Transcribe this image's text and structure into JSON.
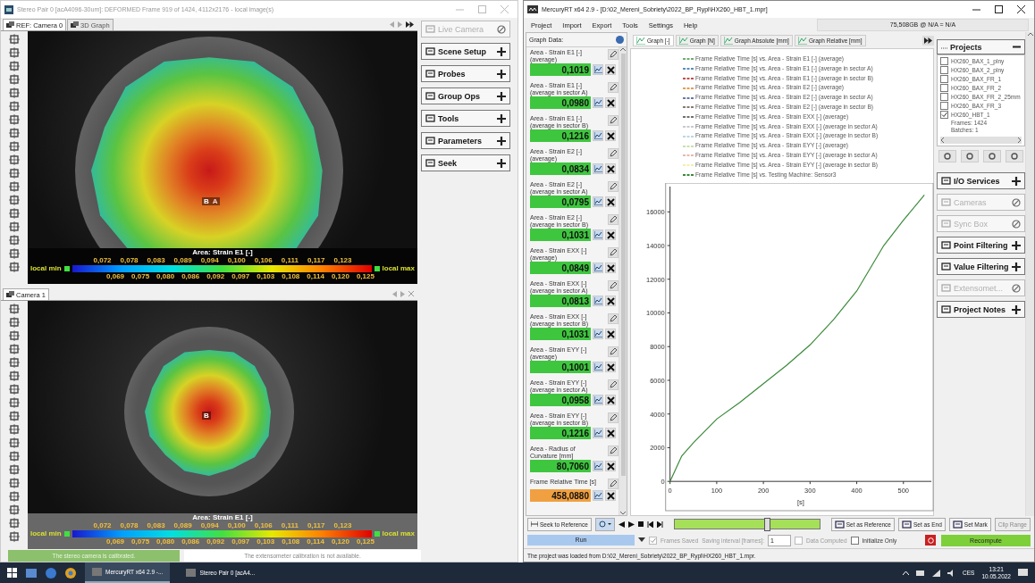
{
  "stereo_window": {
    "title": "Stereo Pair 0 [acA4096-30um]: DEFORMED Frame 919 of 1424, 4112x2176 - local image(s)",
    "viewers": [
      {
        "tabs": [
          {
            "label": "REF: Camera 0",
            "selected": true
          },
          {
            "label": "3D Graph",
            "selected": false
          }
        ],
        "probe_labels": [
          "B",
          "A"
        ],
        "colorbar": {
          "title": "Area: Strain E1 [-]",
          "min_label": "local min",
          "max_label": "local max",
          "upper_ticks": [
            "0,072",
            "0,078",
            "0,083",
            "0,089",
            "0,094",
            "0,100",
            "0,106",
            "0,111",
            "0,117",
            "0,123"
          ],
          "lower_ticks": [
            "0,069",
            "0,075",
            "0,080",
            "0,086",
            "0,092",
            "0,097",
            "0,103",
            "0,108",
            "0,114",
            "0,120",
            "0,125"
          ]
        }
      },
      {
        "tabs": [
          {
            "label": "Camera 1",
            "selected": true
          }
        ],
        "probe_labels": [
          "B"
        ],
        "colorbar": {
          "title": "Area: Strain E1 [-]",
          "min_label": "local min",
          "max_label": "local max",
          "upper_ticks": [
            "0,072",
            "0,078",
            "0,083",
            "0,089",
            "0,094",
            "0,100",
            "0,106",
            "0,111",
            "0,117",
            "0,123"
          ],
          "lower_ticks": [
            "0,069",
            "0,075",
            "0,080",
            "0,086",
            "0,092",
            "0,097",
            "0,103",
            "0,108",
            "0,114",
            "0,120",
            "0,125"
          ]
        }
      }
    ],
    "sidebar": [
      {
        "label": "Live Camera",
        "disabled": true
      },
      {
        "label": "Scene Setup",
        "disabled": false
      },
      {
        "label": "Probes",
        "disabled": false
      },
      {
        "label": "Group Ops",
        "disabled": false
      },
      {
        "label": "Tools",
        "disabled": false
      },
      {
        "label": "Parameters",
        "disabled": false
      },
      {
        "label": "Seek",
        "disabled": false
      }
    ],
    "status": [
      {
        "text": "The stereo camera is calibrated.",
        "kind": "ok"
      },
      {
        "text": "The extensometer calibration is not available.",
        "kind": "info"
      }
    ]
  },
  "mercury_window": {
    "title": "MercuryRT x64 2.9 - [D:\\02_Mereni_Sobriety\\2022_BP_Rypl\\HX260_HBT_1.mpr]",
    "menu": [
      "Project",
      "Import",
      "Export",
      "Tools",
      "Settings",
      "Help"
    ],
    "storage": "75,508GB @ N/A = N/A",
    "graph_data": {
      "title": "Graph Data:",
      "items": [
        {
          "label": "Area - Strain E1 [-]\n(average)",
          "value": "0,1019",
          "color": "#3fc63f"
        },
        {
          "label": "Area - Strain E1 [-]\n(average in sector A)",
          "value": "0,0980",
          "color": "#3fc63f"
        },
        {
          "label": "Area - Strain E1 [-]\n(average in sector B)",
          "value": "0,1216",
          "color": "#3fc63f"
        },
        {
          "label": "Area - Strain E2 [-]\n(average)",
          "value": "0,0834",
          "color": "#3fc63f"
        },
        {
          "label": "Area - Strain E2 [-]\n(average in sector A)",
          "value": "0,0795",
          "color": "#3fc63f"
        },
        {
          "label": "Area - Strain E2 [-]\n(average in sector B)",
          "value": "0,1031",
          "color": "#3fc63f"
        },
        {
          "label": "Area - Strain EXX [-]\n(average)",
          "value": "0,0849",
          "color": "#3fc63f"
        },
        {
          "label": "Area - Strain EXX [-]\n(average in sector A)",
          "value": "0,0813",
          "color": "#3fc63f"
        },
        {
          "label": "Area - Strain EXX [-]\n(average in sector B)",
          "value": "0,1031",
          "color": "#3fc63f"
        },
        {
          "label": "Area - Strain EYY [-]\n(average)",
          "value": "0,1001",
          "color": "#3fc63f"
        },
        {
          "label": "Area - Strain EYY [-]\n(average in sector A)",
          "value": "0,0958",
          "color": "#3fc63f"
        },
        {
          "label": "Area - Strain EYY [-]\n(average in sector B)",
          "value": "0,1216",
          "color": "#3fc63f"
        },
        {
          "label": "Area - Radius of\nCurvature [mm]",
          "value": "80,7060",
          "color": "#3fc63f"
        },
        {
          "label": "Frame Relative Time [s]",
          "value": "458,0880",
          "color": "#f0a040"
        }
      ]
    },
    "graph": {
      "tabs": [
        {
          "label": "Graph [-]",
          "selected": true
        },
        {
          "label": "Graph [N]",
          "selected": false
        },
        {
          "label": "Graph Absolute [mm]",
          "selected": false
        },
        {
          "label": "Graph Relative [mm]",
          "selected": false
        }
      ],
      "chart_data": {
        "type": "line",
        "xlabel": "[s]",
        "x": [
          0,
          25,
          50,
          100,
          150,
          200,
          250,
          300,
          350,
          400,
          458,
          500,
          545
        ],
        "series": [
          {
            "name": "Frame Relative Time [s] vs. Area - Strain E1 [-] (average)",
            "color": "#6fae6f",
            "values": [
              null,
              null,
              null,
              null,
              null,
              null,
              null,
              null,
              null,
              null,
              null,
              null,
              null
            ]
          },
          {
            "name": "Frame Relative Time [s] vs. Area - Strain E1 [-] (average in sector A)",
            "color": "#5a8ec0",
            "values": [
              null,
              null,
              null,
              null,
              null,
              null,
              null,
              null,
              null,
              null,
              null,
              null,
              null
            ]
          },
          {
            "name": "Frame Relative Time [s] vs. Area - Strain E1 [-] (average in sector B)",
            "color": "#c05050",
            "values": [
              null,
              null,
              null,
              null,
              null,
              null,
              null,
              null,
              null,
              null,
              null,
              null,
              null
            ]
          },
          {
            "name": "Frame Relative Time [s] vs. Area - Strain E2 [-] (average)",
            "color": "#e0a050",
            "values": [
              null,
              null,
              null,
              null,
              null,
              null,
              null,
              null,
              null,
              null,
              null,
              null,
              null
            ]
          },
          {
            "name": "Frame Relative Time [s] vs. Area - Strain E2 [-] (average in sector A)",
            "color": "#6a7aa0",
            "values": [
              null,
              null,
              null,
              null,
              null,
              null,
              null,
              null,
              null,
              null,
              null,
              null,
              null
            ]
          },
          {
            "name": "Frame Relative Time [s] vs. Area - Strain E2 [-] (average in sector B)",
            "color": "#8a7a70",
            "values": [
              null,
              null,
              null,
              null,
              null,
              null,
              null,
              null,
              null,
              null,
              null,
              null,
              null
            ]
          },
          {
            "name": "Frame Relative Time [s] vs. Area - Strain EXX [-] (average)",
            "color": "#707070",
            "values": [
              null,
              null,
              null,
              null,
              null,
              null,
              null,
              null,
              null,
              null,
              null,
              null,
              null
            ]
          },
          {
            "name": "Frame Relative Time [s] vs. Area - Strain EXX [-] (average in sector A)",
            "color": "#c8c8d0",
            "values": [
              null,
              null,
              null,
              null,
              null,
              null,
              null,
              null,
              null,
              null,
              null,
              null,
              null
            ]
          },
          {
            "name": "Frame Relative Time [s] vs. Area - Strain EXX [-] (average in sector B)",
            "color": "#b8d8e8",
            "values": [
              null,
              null,
              null,
              null,
              null,
              null,
              null,
              null,
              null,
              null,
              null,
              null,
              null
            ]
          },
          {
            "name": "Frame Relative Time [s] vs. Area - Strain EYY [-] (average)",
            "color": "#c8e0b0",
            "values": [
              null,
              null,
              null,
              null,
              null,
              null,
              null,
              null,
              null,
              null,
              null,
              null,
              null
            ]
          },
          {
            "name": "Frame Relative Time [s] vs. Area - Strain EYY [-] (average in sector A)",
            "color": "#e8b8b0",
            "values": [
              null,
              null,
              null,
              null,
              null,
              null,
              null,
              null,
              null,
              null,
              null,
              null,
              null
            ]
          },
          {
            "name": "Frame Relative Time [s] vs. Area - Strain EYY [-] (average in sector B)",
            "color": "#f0f0b0",
            "values": [
              null,
              null,
              null,
              null,
              null,
              null,
              null,
              null,
              null,
              null,
              null,
              null,
              null
            ]
          },
          {
            "name": "Frame Relative Time [s] vs. Testing Machine: Sensor3",
            "color": "#3a8a3a",
            "values": [
              0,
              1500,
              2300,
              3700,
              4700,
              5800,
              6900,
              8100,
              9600,
              11300,
              14000,
              15500,
              17000
            ]
          }
        ],
        "xlim": [
          0,
          560
        ],
        "ylim": [
          0,
          17500
        ],
        "xticks": [
          0,
          100,
          200,
          300,
          400,
          500
        ],
        "yticks": [
          0,
          2000,
          4000,
          6000,
          8000,
          10000,
          12000,
          14000,
          16000
        ]
      }
    },
    "projects": {
      "title": "Projects",
      "items": [
        {
          "label": "HX260_BAX_1_plny",
          "checked": false
        },
        {
          "label": "HX260_BAX_2_plny",
          "checked": false
        },
        {
          "label": "HX260_BAX_FR_1",
          "checked": false
        },
        {
          "label": "HX260_BAX_FR_2",
          "checked": false
        },
        {
          "label": "HX260_BAX_FR_2_25mm",
          "checked": false
        },
        {
          "label": "HX260_BAX_FR_3",
          "checked": false
        },
        {
          "label": "HX260_HBT_1",
          "checked": true
        }
      ],
      "details": [
        "Frames: 1424",
        "Batches: 1"
      ]
    },
    "sections": [
      {
        "label": "I/O Services",
        "disabled": false
      },
      {
        "label": "Cameras",
        "disabled": true
      },
      {
        "label": "Sync Box",
        "disabled": true
      },
      {
        "label": "Point Filtering",
        "disabled": false
      },
      {
        "label": "Value Filtering",
        "disabled": false
      },
      {
        "label": "Extensomet...",
        "disabled": true
      },
      {
        "label": "Project Notes",
        "disabled": false
      }
    ],
    "seek_bar": {
      "seek_button": "Seek to Reference",
      "slider": {
        "level": 0.64
      },
      "actions": [
        {
          "label": "Set as Reference",
          "disabled": false
        },
        {
          "label": "Set as End",
          "disabled": false
        },
        {
          "label": "Set Mark",
          "disabled": false
        },
        {
          "label": "Clip Range",
          "disabled": true
        }
      ]
    },
    "run_bar": {
      "mode": "Run",
      "checks": [
        {
          "label": "Frames Saved",
          "checked": true,
          "disabled": true
        },
        {
          "label": "Data Computed",
          "checked": false,
          "disabled": true
        },
        {
          "label": "Initialize Only",
          "checked": false,
          "disabled": false
        }
      ],
      "interval_label": "Saving interval [frames]:",
      "interval": "1",
      "recompute": "Recompute"
    },
    "status": "The project was loaded from D:\\02_Mereni_Sobriety\\2022_BP_Rypl\\HX260_HBT_1.mpr."
  },
  "taskbar": {
    "apps": [
      {
        "label": "MercuryRT x64 2.9 -...",
        "selected": true
      },
      {
        "label": "Stereo Pair 0 [acA4...",
        "selected": false
      }
    ],
    "language": "CES",
    "time": "13:21",
    "date": "10.05.2022"
  }
}
